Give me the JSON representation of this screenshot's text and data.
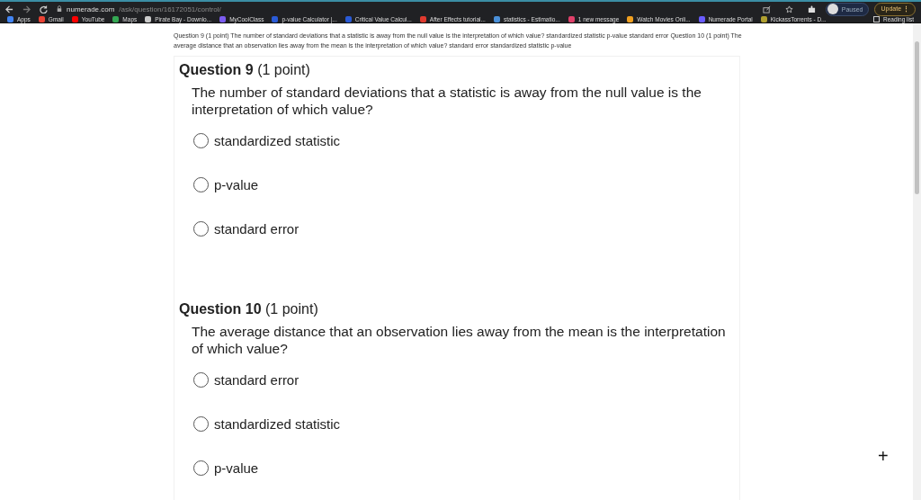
{
  "browser": {
    "url_host": "numerade.com",
    "url_path": "/ask/question/16172051/control/",
    "profile": "Paused",
    "update": "Update",
    "update_menu": "⋮",
    "bookmarks": [
      {
        "label": "Apps",
        "color": "#4285f4"
      },
      {
        "label": "Gmail",
        "color": "#ea4335"
      },
      {
        "label": "YouTube",
        "color": "#ff0000"
      },
      {
        "label": "Maps",
        "color": "#34a853"
      },
      {
        "label": "Pirate Bay - Downlo...",
        "color": "#cccccc"
      },
      {
        "label": "MyCoolClass",
        "color": "#7b5cf0"
      },
      {
        "label": "p-value Calculator |...",
        "color": "#2a5bd7"
      },
      {
        "label": "Critical Value Calcul...",
        "color": "#2a5bd7"
      },
      {
        "label": "After Effects tutorial...",
        "color": "#e03a2f"
      },
      {
        "label": "statistics - Estimatio...",
        "color": "#4a90d9"
      },
      {
        "label": "1 new message",
        "color": "#e0406a"
      },
      {
        "label": "Watch Movies Onli...",
        "color": "#f0a020"
      },
      {
        "label": "Numerade Portal",
        "color": "#6a5cff"
      },
      {
        "label": "KickassTorrents - D...",
        "color": "#b0a030"
      }
    ],
    "reading_list": "Reading list"
  },
  "intro": "Question 9 (1 point) The number of standard deviations that a statistic is away from the null value is the interpretation of which value? standardized statistic p-value standard error Question 10 (1 point) The average distance that an observation lies away from the mean is the interpretation of which value? standard error standardized statistic p-value",
  "questions": [
    {
      "title": "Question 9",
      "points": "(1 point)",
      "text": "The number of standard deviations that a statistic is away from the null value is the interpretation of which value?",
      "options": [
        {
          "label": "standardized statistic",
          "selected": false
        },
        {
          "label": "p-value",
          "selected": false
        },
        {
          "label": "standard error",
          "selected": false
        }
      ]
    },
    {
      "title": "Question 10",
      "points": "(1 point)",
      "text": "The average distance that an observation lies away from the mean is the interpretation of which value?",
      "options": [
        {
          "label": "standard error",
          "selected": false
        },
        {
          "label": "standardized statistic",
          "selected": false
        },
        {
          "label": "p-value",
          "selected": false
        }
      ]
    }
  ],
  "cursor": "+"
}
